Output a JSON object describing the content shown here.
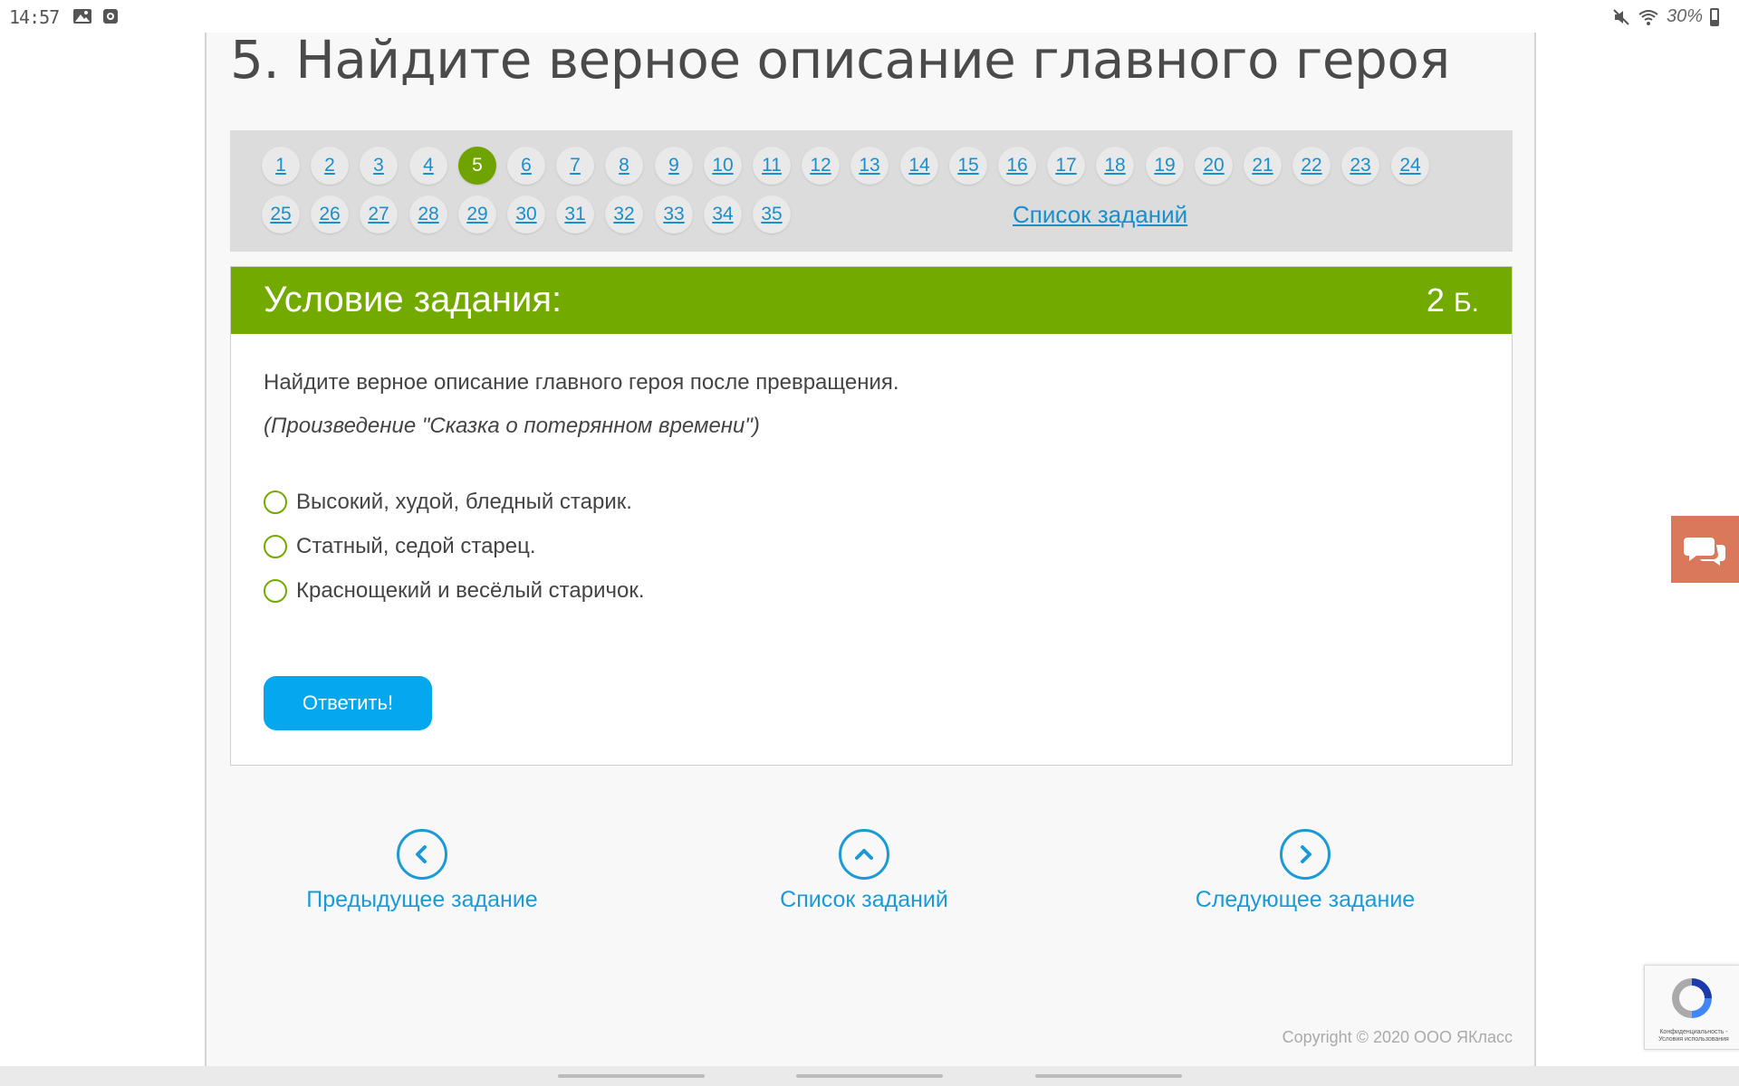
{
  "status_bar": {
    "time": "14:57",
    "battery": "30%",
    "battery_level": 0.3
  },
  "page": {
    "title": "5. Найдите верное описание главного героя",
    "current_task": "5",
    "task_numbers": [
      "1",
      "2",
      "3",
      "4",
      "5",
      "6",
      "7",
      "8",
      "9",
      "10",
      "11",
      "12",
      "13",
      "14",
      "15",
      "16",
      "17",
      "18",
      "19",
      "20",
      "21",
      "22",
      "23",
      "24",
      "25",
      "26",
      "27",
      "28",
      "29",
      "30",
      "31",
      "32",
      "33",
      "34",
      "35"
    ],
    "task_list_link": "Список заданий"
  },
  "task": {
    "header": "Условие задания:",
    "points": "2",
    "points_unit": "Б.",
    "question": "Найдите верное описание главного героя после превращения.",
    "source": "(Произведение \"Сказка о потерянном времени\")",
    "options": [
      "Высокий, худой, бледный старик.",
      "Статный, седой старец.",
      "Краснощекий и весёлый старичок."
    ],
    "submit": "Ответить!"
  },
  "navigation": {
    "prev": "Предыдущее задание",
    "list": "Список заданий",
    "next": "Следующее задание"
  },
  "footer": {
    "copyright": "Copyright © 2020 ООО ЯКласс"
  },
  "recaptcha": {
    "text": "Конфиденциальность - Условия использования"
  },
  "colors": {
    "accent_green": "#72aa00",
    "link_blue": "#1b8fcc",
    "button_blue": "#05a8ee",
    "chat_orange": "#d9785a"
  }
}
